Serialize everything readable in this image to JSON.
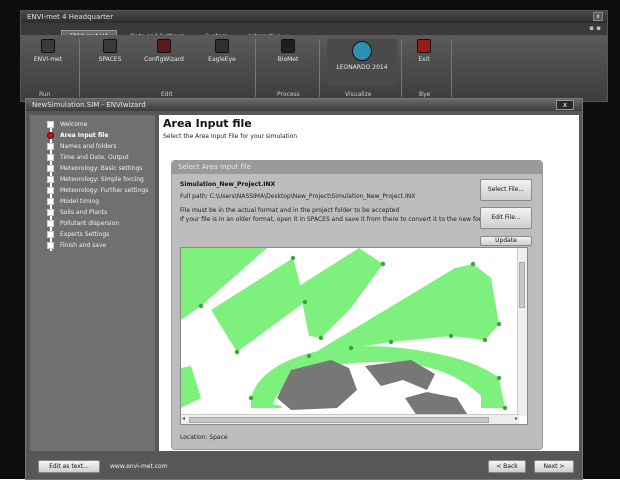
{
  "hq": {
    "title": "ENVI-met 4 Headquarter",
    "close": "x",
    "tabs": [
      "ENVI-met V4",
      "Data and Settings",
      "System",
      "Interactive"
    ],
    "active_tab": 0,
    "tab_controls": "▪ ▪",
    "ribbon": {
      "buttons": [
        {
          "label": "ENVI-met",
          "icon": "envimet-run-icon",
          "color": "#3a3a3a"
        },
        {
          "label": "SPACES",
          "icon": "spaces-icon",
          "color": "#3a3a3a"
        },
        {
          "label": "ConfigWizard",
          "icon": "config-wizard-icon",
          "color": "#5a1a1a"
        },
        {
          "label": "EagleEye",
          "icon": "eagle-eye-icon",
          "color": "#2f2f2f"
        },
        {
          "label": "BioMet",
          "icon": "biomet-icon",
          "color": "#1e1e1e"
        },
        {
          "label": "LEONARDO 2014",
          "icon": "leonardo-icon",
          "color": "#2a8fb0"
        },
        {
          "label": "Exit",
          "icon": "exit-icon",
          "color": "#9b1b1b"
        }
      ],
      "groups": [
        "Run",
        "Edit",
        "Process",
        "Visualize",
        "Bye"
      ]
    }
  },
  "wizard": {
    "title": "NewSimulation.SIM - ENVIwizard",
    "close": "x",
    "steps": [
      "Welcome",
      "Area Input file",
      "Names and folders",
      "Time and Date, Output",
      "Meteorology: Basic settings",
      "Meteorology: Simple forcing",
      "Meteorology: Further settings",
      "Model timing",
      "Soils and Plants",
      "Pollutant dispersion",
      "Experts Settings",
      "Finish and save"
    ],
    "current_step": 1,
    "page_title": "Area Input file",
    "page_subtitle": "Select the Area Input File for your simulation",
    "panel": {
      "header": "Select Area Input file",
      "file_name": "Simulation_New_Project.INX",
      "full_path": "Full path:  C:\\Users\\NASSIMA\\Desktop\\New_Project\\Simulation_New_Project.INX",
      "note1": "File must be in the actual format and in the project folder to be accepted",
      "note2": "If your file is in an older format, open it in SPACES and save it from there to convert it to the new format",
      "select_button": "Select File...",
      "edit_button": "Edit File...",
      "update_button": "Update",
      "location": "Location:  Space"
    },
    "map_colors": {
      "vegetation": "#7ef07e",
      "building": "#777777",
      "ground": "#ffffff",
      "points": "#3aa63a"
    },
    "footer": {
      "edit_text_button": "Edit as text...",
      "website": "www.envi-met.com",
      "back_button": "< Back",
      "next_button": "Next >"
    }
  }
}
